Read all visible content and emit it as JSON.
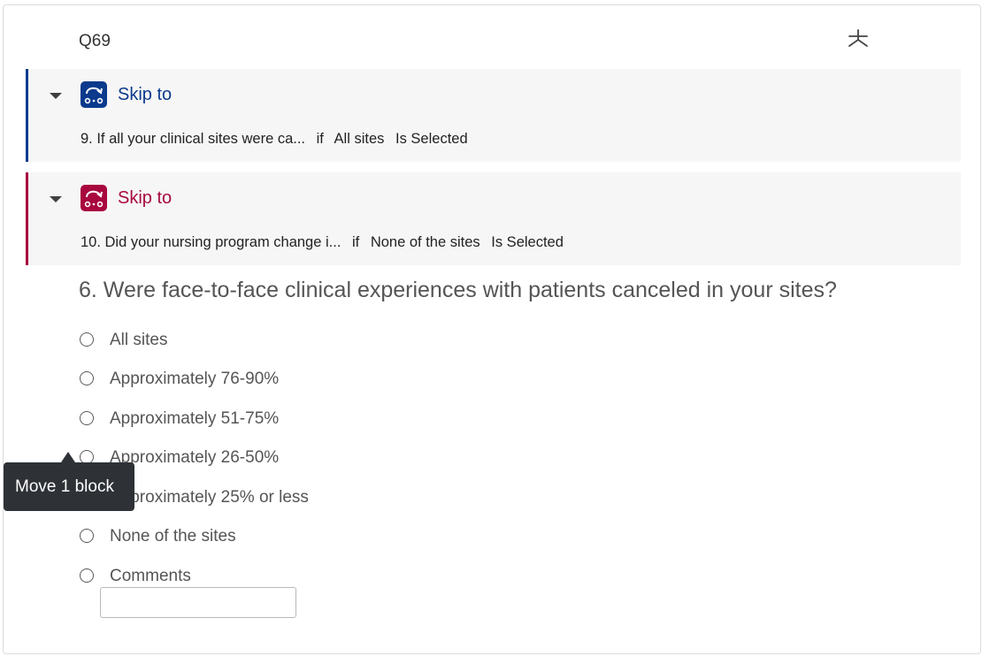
{
  "question": {
    "id": "Q69",
    "text": "6. Were face-to-face clinical experiences with patients canceled in your sites?"
  },
  "logic": [
    {
      "type_label": "Skip to",
      "target": "9. If all your clinical sites were ca...",
      "if_word": "if",
      "choice": "All sites",
      "operator": "Is Selected",
      "accent": "#0b3a8c"
    },
    {
      "type_label": "Skip to",
      "target": "10. Did your nursing program change i...",
      "if_word": "if",
      "choice": "None of the sites",
      "operator": "Is Selected",
      "accent": "#a8083e"
    }
  ],
  "choices": [
    "All sites",
    "Approximately 76-90%",
    "Approximately 51-75%",
    "Approximately 26-50%",
    "Approximately 25% or less",
    "None of the sites",
    "Comments"
  ],
  "comments_input": {
    "value": "",
    "placeholder": ""
  },
  "tooltip": {
    "text": "Move 1 block"
  },
  "icons": {
    "favorite": "asterisk-star-icon",
    "collapse": "caret-down-icon",
    "skip": "skip-logic-icon"
  }
}
